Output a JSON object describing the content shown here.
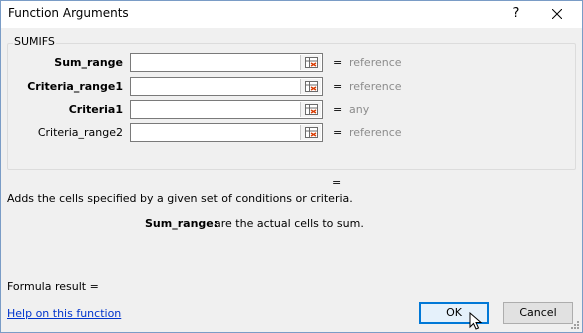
{
  "window": {
    "title": "Function Arguments",
    "help_glyph": "?"
  },
  "group": {
    "label": "SUMIFS"
  },
  "arguments": [
    {
      "label": "Sum_range",
      "bold": true,
      "value": "",
      "result": "reference"
    },
    {
      "label": "Criteria_range1",
      "bold": true,
      "value": "",
      "result": "reference"
    },
    {
      "label": "Criteria1",
      "bold": true,
      "value": "",
      "result": "any"
    },
    {
      "label": "Criteria_range2",
      "bold": false,
      "value": "",
      "result": "reference"
    }
  ],
  "equals_sign": "=",
  "description": "Adds the cells specified by a given set of conditions or criteria.",
  "current_arg": {
    "name": "Sum_range:",
    "text": "are the actual cells to sum."
  },
  "formula_result": "Formula result =",
  "help_link": "Help on this function",
  "buttons": {
    "ok": "OK",
    "cancel": "Cancel"
  },
  "colors": {
    "accent": "#0078d7",
    "link": "#0033cc",
    "muted": "#8c8c8c"
  }
}
